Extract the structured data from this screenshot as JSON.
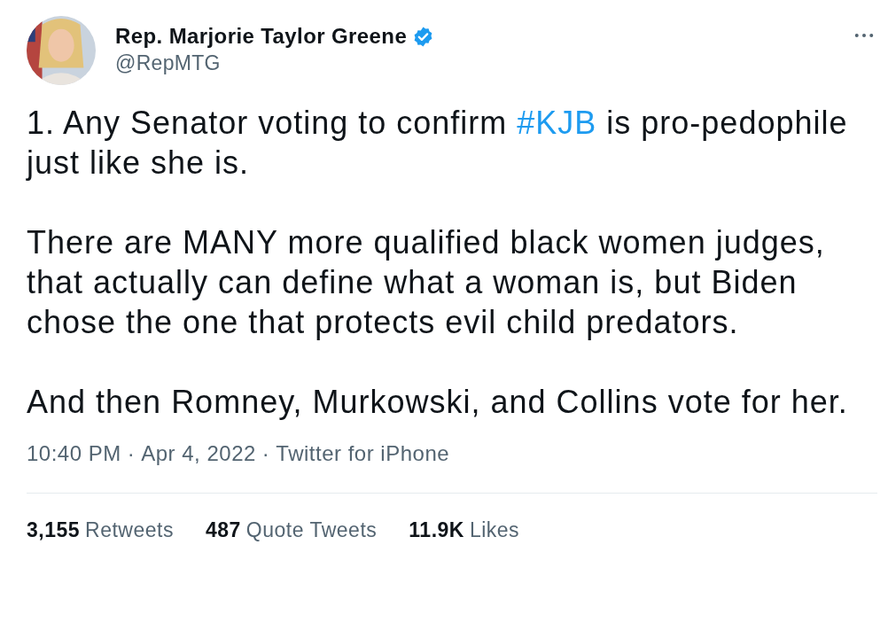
{
  "author": {
    "name": "Rep. Marjorie Taylor Greene",
    "verified": true,
    "handle": "@RepMTG"
  },
  "tweet": {
    "paragraphs": [
      [
        {
          "kind": "text",
          "text": "1. Any Senator voting to confirm "
        },
        {
          "kind": "hashtag",
          "text": "#KJB"
        },
        {
          "kind": "text",
          "text": " is pro-pedophile just like she is."
        }
      ],
      [
        {
          "kind": "text",
          "text": "There are MANY more qualified black women judges, that actually can define what a woman is, but Biden chose the one that protects evil child predators."
        }
      ],
      [
        {
          "kind": "text",
          "text": "And then Romney, Murkowski, and Collins vote for her."
        }
      ]
    ]
  },
  "meta": [
    "10:40 PM",
    "·",
    "Apr 4, 2022",
    "·",
    "Twitter for iPhone"
  ],
  "stats": [
    {
      "count": "3,155",
      "label": "Retweets"
    },
    {
      "count": "487",
      "label": "Quote Tweets"
    },
    {
      "count": "11.9K",
      "label": "Likes"
    }
  ]
}
